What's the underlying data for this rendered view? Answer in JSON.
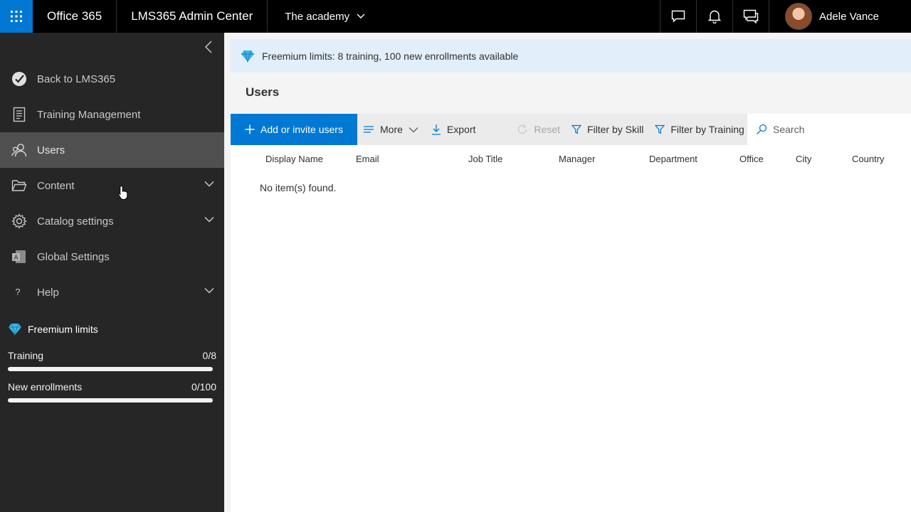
{
  "topbar": {
    "brand": "Office 365",
    "app": "LMS365 Admin Center",
    "site": "The academy",
    "user_name": "Adele Vance"
  },
  "sidebar": {
    "items": [
      {
        "label": "Back to LMS365",
        "icon": "checkmark-circle-icon"
      },
      {
        "label": "Training Management",
        "icon": "document-icon"
      },
      {
        "label": "Users",
        "icon": "people-icon",
        "active": true
      },
      {
        "label": "Content",
        "icon": "folder-icon",
        "expandable": true
      },
      {
        "label": "Catalog settings",
        "icon": "gear-icon",
        "expandable": true
      },
      {
        "label": "Global Settings",
        "icon": "settings-app-icon"
      },
      {
        "label": "Help",
        "icon": "question-icon",
        "expandable": true
      }
    ],
    "limits": {
      "title": "Freemium limits",
      "training_label": "Training",
      "training_value": "0/8",
      "training_fraction": 0,
      "enroll_label": "New enrollments",
      "enroll_value": "0/100",
      "enroll_fraction": 0
    }
  },
  "main": {
    "banner": "Freemium limits: 8 training, 100 new enrollments available",
    "title": "Users",
    "toolbar": {
      "add": "Add or invite users",
      "more": "More",
      "export": "Export",
      "reset": "Reset",
      "filter_skill": "Filter by Skill",
      "filter_training": "Filter by Training",
      "search_placeholder": "Search"
    },
    "columns": [
      "Display Name",
      "Email",
      "Job Title",
      "Manager",
      "Department",
      "Office",
      "City",
      "Country"
    ],
    "empty_message": "No item(s) found."
  },
  "colors": {
    "accent": "#0078d4",
    "topbar": "#000000",
    "sidebar": "#262626",
    "banner": "#e2eef9"
  }
}
